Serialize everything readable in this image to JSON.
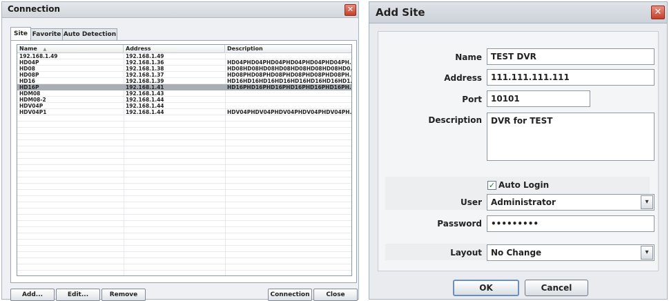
{
  "connection_window": {
    "title": "Connection",
    "close_glyph": "✕",
    "tabs": [
      {
        "label": "Site",
        "active": true
      },
      {
        "label": "Favorite",
        "active": false
      },
      {
        "label": "Auto Detection",
        "active": false
      }
    ],
    "columns": [
      "Name",
      "Address",
      "Description"
    ],
    "sort_indicator": "▲",
    "rows": [
      {
        "name": "192.168.1.49",
        "address": "192.168.1.49",
        "description": ""
      },
      {
        "name": "HD04P",
        "address": "192.168.1.36",
        "description": "HD04PHD04PHD04PHD04PHD04PHD04PH..."
      },
      {
        "name": "HD08",
        "address": "192.168.1.38",
        "description": "HD08HD08HD08HD08HD08HD08HD08HD0..."
      },
      {
        "name": "HD08P",
        "address": "192.168.1.37",
        "description": "HD08PHD08PHD08PHD08PHD08PHD08PH..."
      },
      {
        "name": "HD16",
        "address": "192.168.1.39",
        "description": "HD16HD16HD16HD16HD16HD16HD16HD1..."
      },
      {
        "name": "HD16P",
        "address": "192.168.1.41",
        "description": "HD16PHD16PHD16PHD16PHD16PHD16PH...",
        "selected": true
      },
      {
        "name": "HDM08",
        "address": "192.168.1.43",
        "description": ""
      },
      {
        "name": "HDM08-2",
        "address": "192.168.1.44",
        "description": ""
      },
      {
        "name": "HDV04P",
        "address": "192.168.1.44",
        "description": ""
      },
      {
        "name": "HDV04P1",
        "address": "192.168.1.44",
        "description": "HDV04PHDV04PHDV04PHDV04PHDV04PH..."
      }
    ],
    "buttons": {
      "add": "Add...",
      "edit": "Edit...",
      "remove": "Remove",
      "connection": "Connection",
      "close": "Close"
    }
  },
  "add_site_window": {
    "title": "Add Site",
    "close_glyph": "✕",
    "labels": {
      "name": "Name",
      "address": "Address",
      "port": "Port",
      "description": "Description",
      "auto_login": "Auto Login",
      "user": "User",
      "password": "Password",
      "layout": "Layout"
    },
    "values": {
      "name": "TEST DVR",
      "address": "111.111.111.111",
      "port": "10101",
      "description": "DVR for TEST",
      "auto_login_checked": true,
      "check_glyph": "✓",
      "user": "Administrator",
      "password": "•••••••••",
      "layout": "No Change"
    },
    "dropdown_glyph": "▾",
    "buttons": {
      "ok": "OK",
      "cancel": "Cancel"
    }
  }
}
